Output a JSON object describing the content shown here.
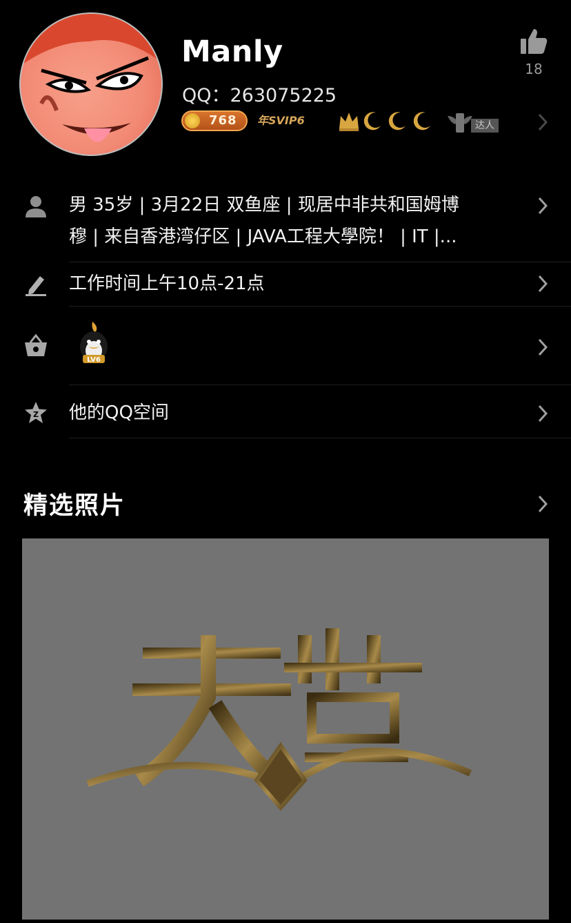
{
  "profile": {
    "name": "Manly",
    "qq": "QQ：263075225",
    "level_badge": "768",
    "svip_badge": "年SVIP6",
    "daren_badge": "达人",
    "likes": "18"
  },
  "info": {
    "details_line1": "男 35岁 | 3月22日 双鱼座 | 现居中非共和国姆博",
    "details_line2": "穆 | 来自香港湾仔区 | JAVA工程大學院！ | IT |...",
    "signature": "工作时间上午10点-21点",
    "qzone": "他的QQ空间"
  },
  "featured": {
    "title": "精选照片"
  },
  "colors": {
    "background": "#000000",
    "gold": "#d8a640",
    "photo_bg": "#737373"
  },
  "icons": [
    "like-icon",
    "user-icon",
    "edit-icon",
    "bag-icon",
    "qzone-star-icon",
    "chevron-right-icon"
  ]
}
